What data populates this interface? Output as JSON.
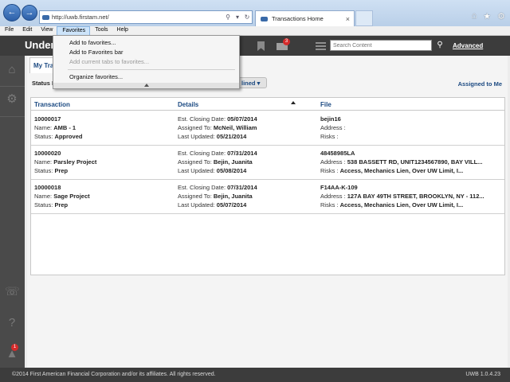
{
  "browser": {
    "address_url": "http://uwb.firstam.net/",
    "tab_title": "Transactions Home",
    "menu": [
      "File",
      "Edit",
      "View",
      "Favorites",
      "Tools",
      "Help"
    ],
    "active_menu": "Favorites",
    "favorites_menu": {
      "add_to_favorites": "Add to favorites...",
      "add_to_favorites_bar": "Add to Favorites bar",
      "add_tabs": "Add current tabs to favorites...",
      "organize": "Organize favorites..."
    }
  },
  "app": {
    "title": "Under",
    "mail_badge": "3",
    "search_placeholder": "Search Content",
    "advanced_label": "Advanced",
    "notification_badge": "1"
  },
  "main": {
    "tab_label": "My Tra",
    "status_label": "Status Fi",
    "filter_value": "lined",
    "assigned_to_me": "Assigned to Me",
    "columns": [
      "Transaction",
      "Details",
      "File"
    ],
    "rows": [
      {
        "id": "10000017",
        "name_label": "Name: ",
        "name": "AMB - 1",
        "status_label": "Status: ",
        "status": "Approved",
        "closing_label": "Est. Closing Date: ",
        "closing": "05/07/2014",
        "assigned_label": "Assigned To: ",
        "assigned": "McNeil, William",
        "updated_label": "Last Updated: ",
        "updated": "05/21/2014",
        "file": "bejin16",
        "address_label": "Address : ",
        "address": "",
        "risks_label": "Risks : ",
        "risks": ""
      },
      {
        "id": "10000020",
        "name_label": "Name: ",
        "name": "Parsley Project",
        "status_label": "Status: ",
        "status": "Prep",
        "closing_label": "Est. Closing Date: ",
        "closing": "07/31/2014",
        "assigned_label": "Assigned To: ",
        "assigned": "Bejin, Juanita",
        "updated_label": "Last Updated: ",
        "updated": "05/08/2014",
        "file": "48458985LA",
        "address_label": "Address : ",
        "address": "538 BASSETT RD, UNIT1234567890, BAY VILL...",
        "risks_label": "Risks : ",
        "risks": "Access, Mechanics Lien, Over UW Limit, I..."
      },
      {
        "id": "10000018",
        "name_label": "Name: ",
        "name": "Sage Project",
        "status_label": "Status: ",
        "status": "Prep",
        "closing_label": "Est. Closing Date: ",
        "closing": "07/31/2014",
        "assigned_label": "Assigned To: ",
        "assigned": "Bejin, Juanita",
        "updated_label": "Last Updated: ",
        "updated": "05/07/2014",
        "file": "F14AA-K-109",
        "address_label": "Address : ",
        "address": "127A BAY 49TH STREET, BROOKLYN, NY - 112...",
        "risks_label": "Risks : ",
        "risks": "Access, Mechanics Lien, Over UW Limit, I..."
      }
    ]
  },
  "footer": {
    "copyright": "©2014 First American Financial Corporation and/or its affiliates. All rights reserved.",
    "version": "UWB 1.0.4.23"
  }
}
